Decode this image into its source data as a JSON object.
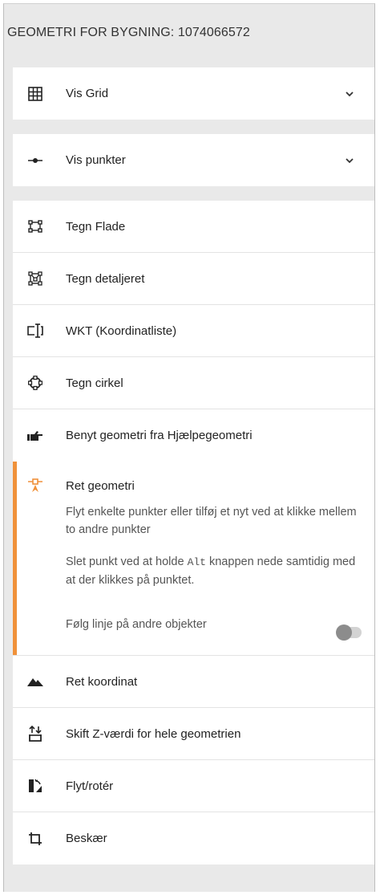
{
  "panel": {
    "title": "GEOMETRI FOR BYGNING: 1074066572"
  },
  "accordions": [
    {
      "label": "Vis Grid",
      "icon": "grid-icon"
    },
    {
      "label": "Vis punkter",
      "icon": "points-line-icon"
    }
  ],
  "tools": [
    {
      "label": "Tegn Flade",
      "icon": "draw-area-icon"
    },
    {
      "label": "Tegn detaljeret",
      "icon": "draw-detailed-icon"
    },
    {
      "label": "WKT (Koordinatliste)",
      "icon": "wkt-text-icon"
    },
    {
      "label": "Tegn cirkel",
      "icon": "draw-circle-icon"
    },
    {
      "label": "Benyt geometri fra Hjælpegeometri",
      "icon": "hand-pointer-icon"
    }
  ],
  "active_tool": {
    "label": "Ret geometri",
    "icon": "edit-vertex-icon",
    "accent_color": "#f0913a",
    "desc1": "Flyt enkelte punkter eller tilføj et nyt ved at klikke mellem to andre punkter",
    "desc2_before": "Slet punkt ved at holde ",
    "desc2_key": "Alt",
    "desc2_after": " knappen nede samtidig med at der klikkes på punktet.",
    "toggle_label": "Følg linje på andre objekter",
    "toggle_on": false
  },
  "more_tools": [
    {
      "label": "Ret koordinat",
      "icon": "terrain-icon"
    },
    {
      "label": "Skift Z-værdi for hele geometrien",
      "icon": "z-value-icon"
    },
    {
      "label": "Flyt/rotér",
      "icon": "move-rotate-icon"
    },
    {
      "label": "Beskær",
      "icon": "crop-icon"
    }
  ]
}
